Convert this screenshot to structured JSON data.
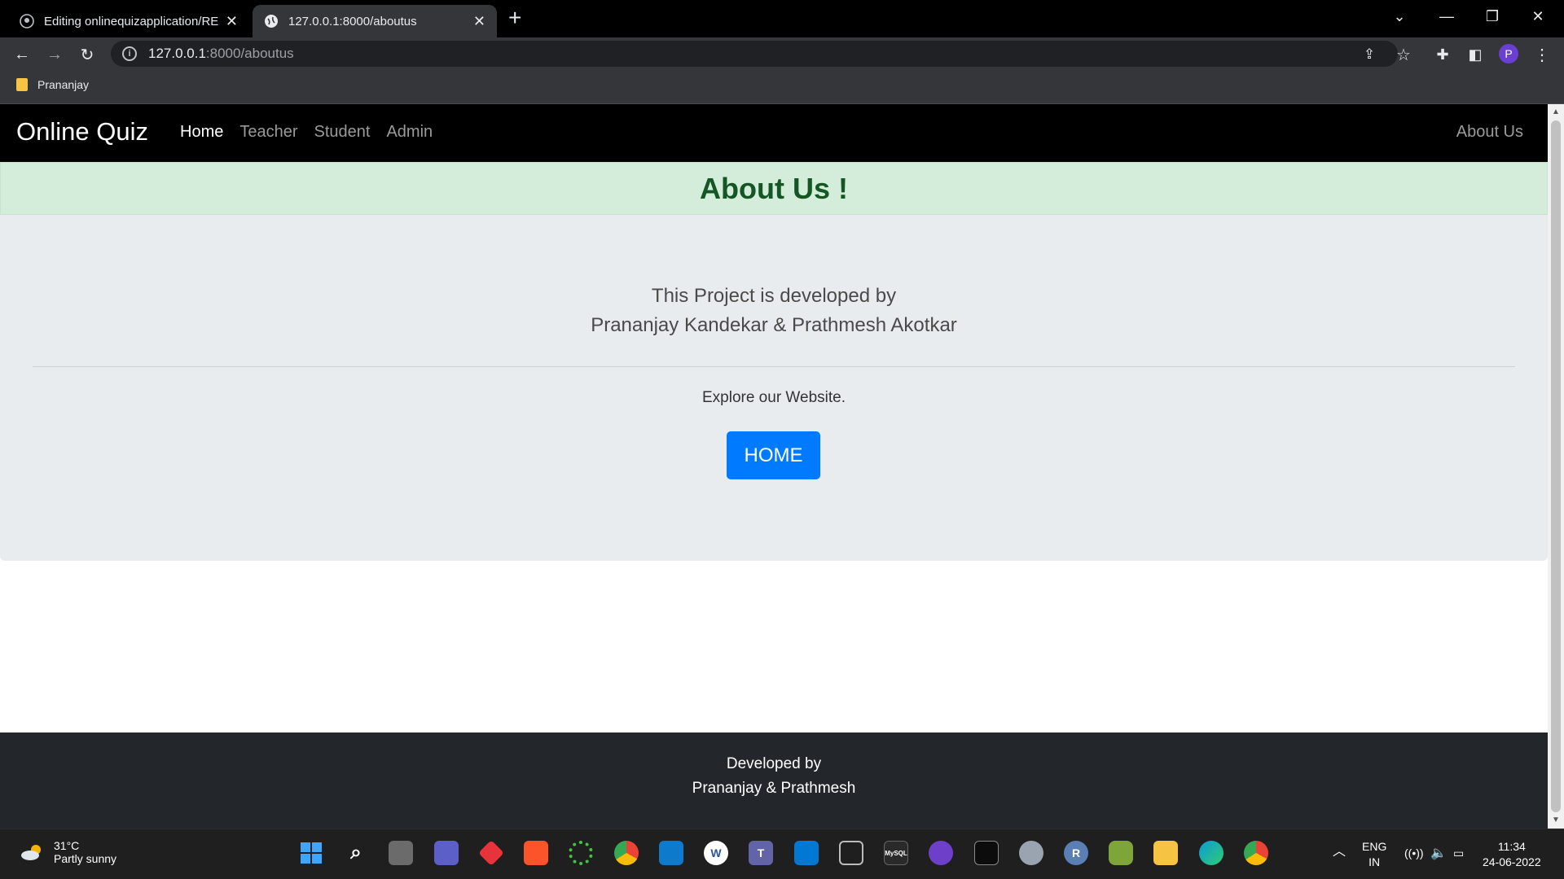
{
  "browser": {
    "tabs": [
      {
        "title": "Editing onlinequizapplication/RE",
        "active": false
      },
      {
        "title": "127.0.0.1:8000/aboutus",
        "active": true
      }
    ],
    "url_host": "127.0.0.1",
    "url_path": ":8000/aboutus",
    "profile_initial": "P",
    "bookmark": "Prananjay"
  },
  "site": {
    "brand": "Online Quiz",
    "nav": [
      "Home",
      "Teacher",
      "Student",
      "Admin"
    ],
    "nav_right": "About Us",
    "alert_title": "About Us !",
    "lead_line1": "This Project is developed by",
    "lead_line2": "Prananjay Kandekar & Prathmesh Akotkar",
    "explore": "Explore our Website.",
    "home_button": "HOME",
    "footer_line1": "Developed by",
    "footer_line2": "Prananjay & Prathmesh"
  },
  "taskbar": {
    "temp": "31°C",
    "condition": "Partly sunny",
    "lang1": "ENG",
    "lang2": "IN",
    "time": "11:34",
    "date": "24-06-2022"
  },
  "colors": {
    "navbar": "#000000",
    "alert_bg": "#d4edda",
    "alert_text": "#155724",
    "jumbotron": "#e9ecef",
    "button": "#007bff",
    "footer": "#23272b"
  }
}
